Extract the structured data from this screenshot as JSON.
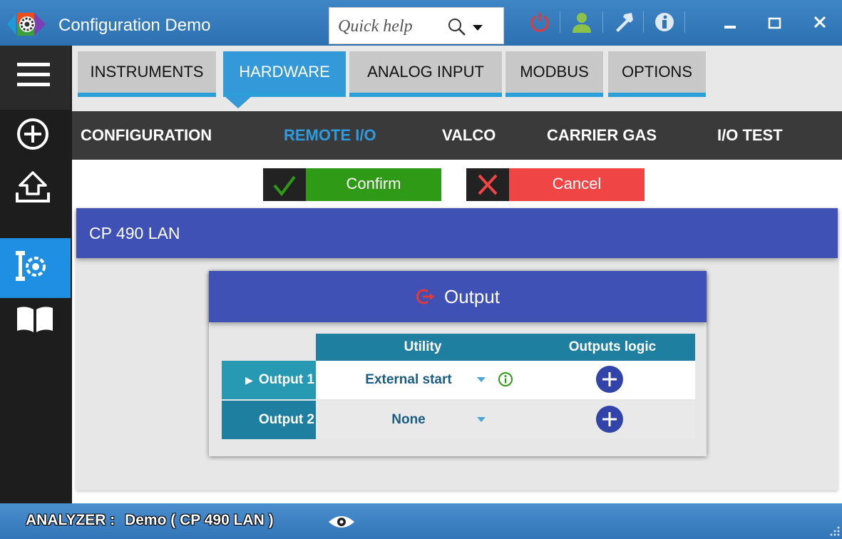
{
  "window": {
    "title": "Configuration Demo",
    "quick_help_placeholder": "Quick help",
    "icons": [
      "app-gear-icon",
      "search-icon",
      "chevron-down-icon",
      "power-icon",
      "user-icon",
      "hammer-icon",
      "info-icon",
      "minimize-icon",
      "maximize-icon",
      "close-icon"
    ]
  },
  "sidebar": {
    "items": [
      {
        "icon": "menu-icon"
      },
      {
        "icon": "add-circle-icon"
      },
      {
        "icon": "upload-icon"
      },
      {
        "icon": "settings-tools-icon",
        "active": true
      },
      {
        "icon": "book-icon"
      }
    ]
  },
  "main_tabs": [
    "INSTRUMENTS",
    "HARDWARE",
    "ANALOG INPUT",
    "MODBUS",
    "OPTIONS"
  ],
  "main_tab_active": "HARDWARE",
  "sub_tabs": [
    "CONFIGURATION",
    "REMOTE I/O",
    "VALCO",
    "CARRIER GAS",
    "I/O TEST"
  ],
  "sub_tab_active": "REMOTE I/O",
  "actions": {
    "confirm": "Confirm",
    "cancel": "Cancel"
  },
  "device": {
    "name": "CP 490 LAN"
  },
  "output_panel": {
    "title": "Output",
    "columns": [
      "",
      "Utility",
      "Outputs logic"
    ],
    "rows": [
      {
        "name": "Output 1",
        "utility": "External start",
        "expanded_marker": "▶",
        "info": true
      },
      {
        "name": "Output 2",
        "utility": "None",
        "info": false
      }
    ]
  },
  "status_bar": {
    "label": "ANALYZER :",
    "value": "Demo ( CP 490 LAN )"
  },
  "colors": {
    "title_bar": "#2f73b4",
    "sidebar": "#1d1d1d",
    "sidebar_active": "#1e8fe3",
    "tab_active": "#3399d8",
    "subnav": "#3a3a3a",
    "subnav_active": "#2e9be0",
    "confirm": "#2f9a16",
    "cancel": "#f04545",
    "header_indigo": "#3f51b5",
    "table_header": "#1f7fa0"
  }
}
